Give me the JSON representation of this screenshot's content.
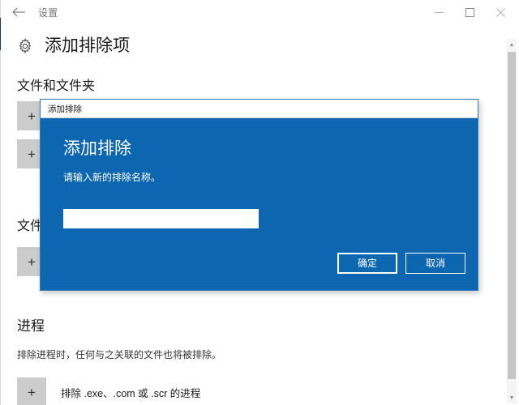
{
  "window": {
    "titlebar_title": "设置",
    "back_icon": "back-arrow-icon",
    "minimize_label": "—",
    "maximize_label": "▢",
    "close_label": "✕"
  },
  "page": {
    "icon": "gear-icon",
    "title": "添加排除项",
    "sections": [
      {
        "heading": "文件和文件夹",
        "rows": [
          {
            "plus": "+",
            "label": ""
          },
          {
            "plus": "+",
            "label": ""
          }
        ]
      },
      {
        "heading": "文件",
        "rows": [
          {
            "plus": "+",
            "label": ""
          }
        ]
      },
      {
        "heading": "进程",
        "desc": "排除进程时，任何与之关联的文件也将被排除。",
        "rows": [
          {
            "plus": "+",
            "label": "排除 .exe、.com 或 .scr 的进程"
          }
        ]
      }
    ]
  },
  "scrollbar": {
    "up_arrow": "▲",
    "down_arrow": "▼"
  },
  "dialog": {
    "titlebar_title": "添加排除",
    "heading": "添加排除",
    "subtext": "请输入新的排除名称。",
    "input_value": "",
    "input_placeholder": "",
    "ok_label": "确定",
    "cancel_label": "取消",
    "accent_color": "#0c66b0"
  }
}
